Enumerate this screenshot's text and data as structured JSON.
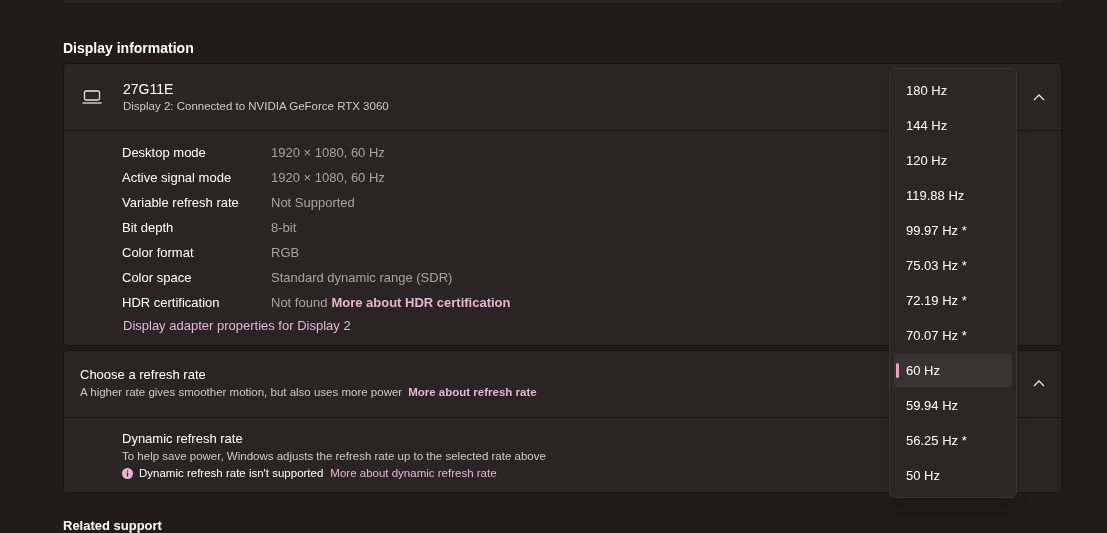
{
  "section_title": "Display information",
  "display": {
    "name": "27G11E",
    "subtitle": "Display 2: Connected to NVIDIA GeForce RTX 3060",
    "expanded": true,
    "properties": [
      {
        "label": "Desktop mode",
        "value": "1920 × 1080, 60 Hz"
      },
      {
        "label": "Active signal mode",
        "value": "1920 × 1080, 60 Hz"
      },
      {
        "label": "Variable refresh rate",
        "value": "Not Supported"
      },
      {
        "label": "Bit depth",
        "value": "8-bit"
      },
      {
        "label": "Color format",
        "value": "RGB"
      },
      {
        "label": "Color space",
        "value": "Standard dynamic range (SDR)"
      },
      {
        "label": "HDR certification",
        "value": "Not found",
        "link": "More about HDR certification"
      }
    ],
    "adapter_link": "Display adapter properties for Display 2"
  },
  "refresh": {
    "title": "Choose a refresh rate",
    "description": "A higher rate gives smoother motion, but also uses more power",
    "link": "More about refresh rate",
    "expanded": true,
    "dynamic": {
      "title": "Dynamic refresh rate",
      "description": "To help save power, Windows adjusts the refresh rate up to the selected rate above",
      "warning": "Dynamic refresh rate isn't supported",
      "link": "More about dynamic refresh rate"
    }
  },
  "refresh_options": [
    {
      "label": "180 Hz",
      "selected": false
    },
    {
      "label": "144 Hz",
      "selected": false
    },
    {
      "label": "120 Hz",
      "selected": false
    },
    {
      "label": "119.88 Hz",
      "selected": false
    },
    {
      "label": "99.97 Hz *",
      "selected": false
    },
    {
      "label": "75.03 Hz *",
      "selected": false
    },
    {
      "label": "72.19 Hz *",
      "selected": false
    },
    {
      "label": "70.07 Hz *",
      "selected": false
    },
    {
      "label": "60 Hz",
      "selected": true
    },
    {
      "label": "59.94 Hz",
      "selected": false
    },
    {
      "label": "56.25 Hz *",
      "selected": false
    },
    {
      "label": "50 Hz",
      "selected": false
    }
  ],
  "next_section_title": "Related support"
}
